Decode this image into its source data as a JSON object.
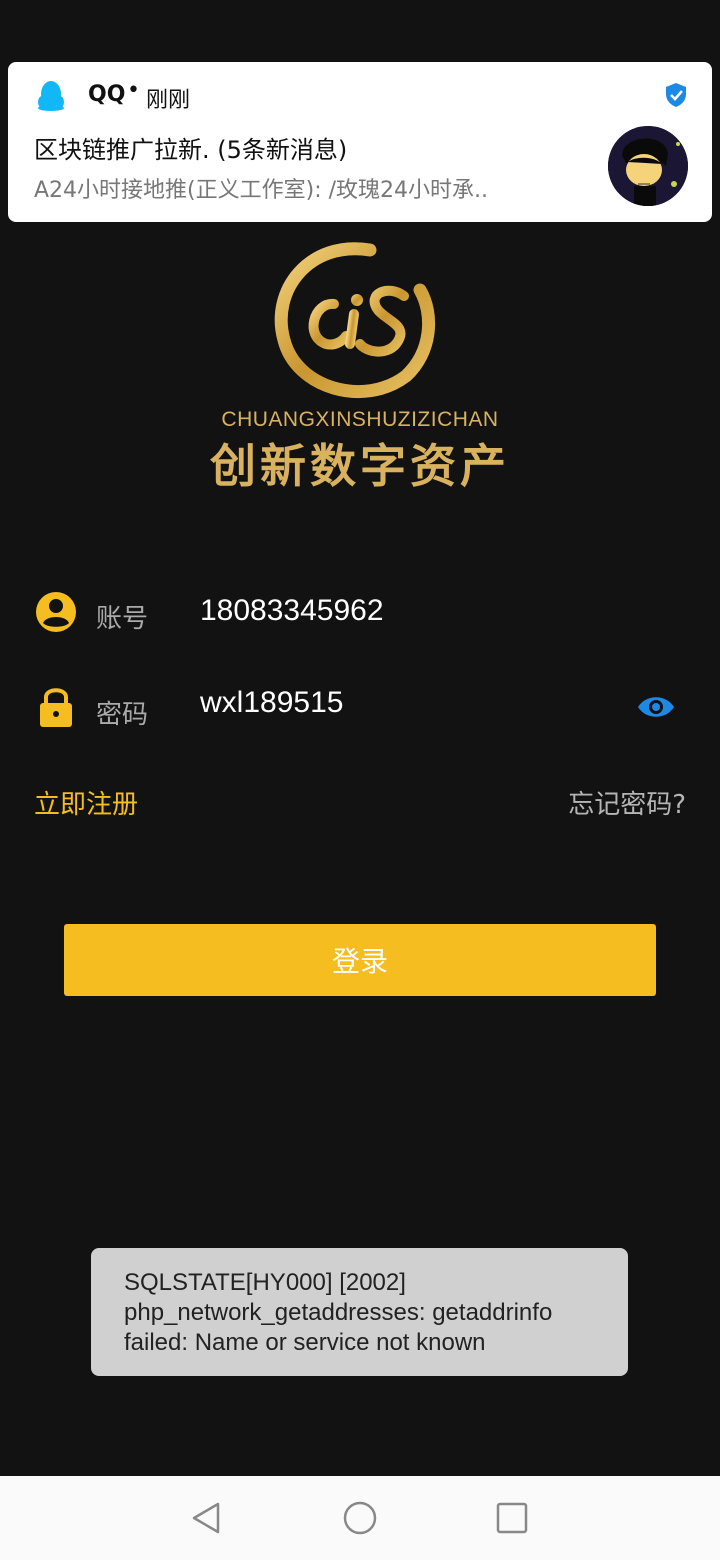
{
  "notification": {
    "app_name": "QQ",
    "separator": "•",
    "time": "刚刚",
    "title": "区块链推广拉新. (5条新消息)",
    "body": "A24小时接地推(正义工作室): /玫瑰24小时承..",
    "app_icon": "qq-penguin-icon",
    "verified_icon": "shield-check-icon"
  },
  "logo": {
    "subtitle": "CHUANGXINSHUZIZICHAN",
    "name_cn": "创新数字资产"
  },
  "form": {
    "account_label": "账号",
    "account_value": "18083345962",
    "password_label": "密码",
    "password_value": "wxl189515",
    "register_link": "立即注册",
    "forgot_link": "忘记密码?",
    "login_button": "登录"
  },
  "toast": {
    "message": "SQLSTATE[HY000] [2002] php_network_getaddresses: getaddrinfo failed: Name or service not known"
  },
  "colors": {
    "accent": "#f5bd1f",
    "logo_gold": "#d9b25f",
    "eye_blue": "#1e88e5",
    "background": "#121212"
  }
}
